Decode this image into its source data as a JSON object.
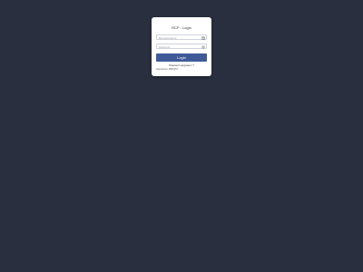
{
  "login": {
    "title": "RCP - Login",
    "username_placeholder": "Benutzername",
    "password_placeholder": "Passwort",
    "button_label": "Login",
    "forgot_password_link": "Passwort vergessen ?",
    "version_text": "Appversion 4560470"
  },
  "icons": {
    "username": "id-card-icon",
    "password": "gear-icon"
  },
  "colors": {
    "background": "#2a2f3f",
    "card": "#ffffff",
    "button": "#3f5a97"
  }
}
